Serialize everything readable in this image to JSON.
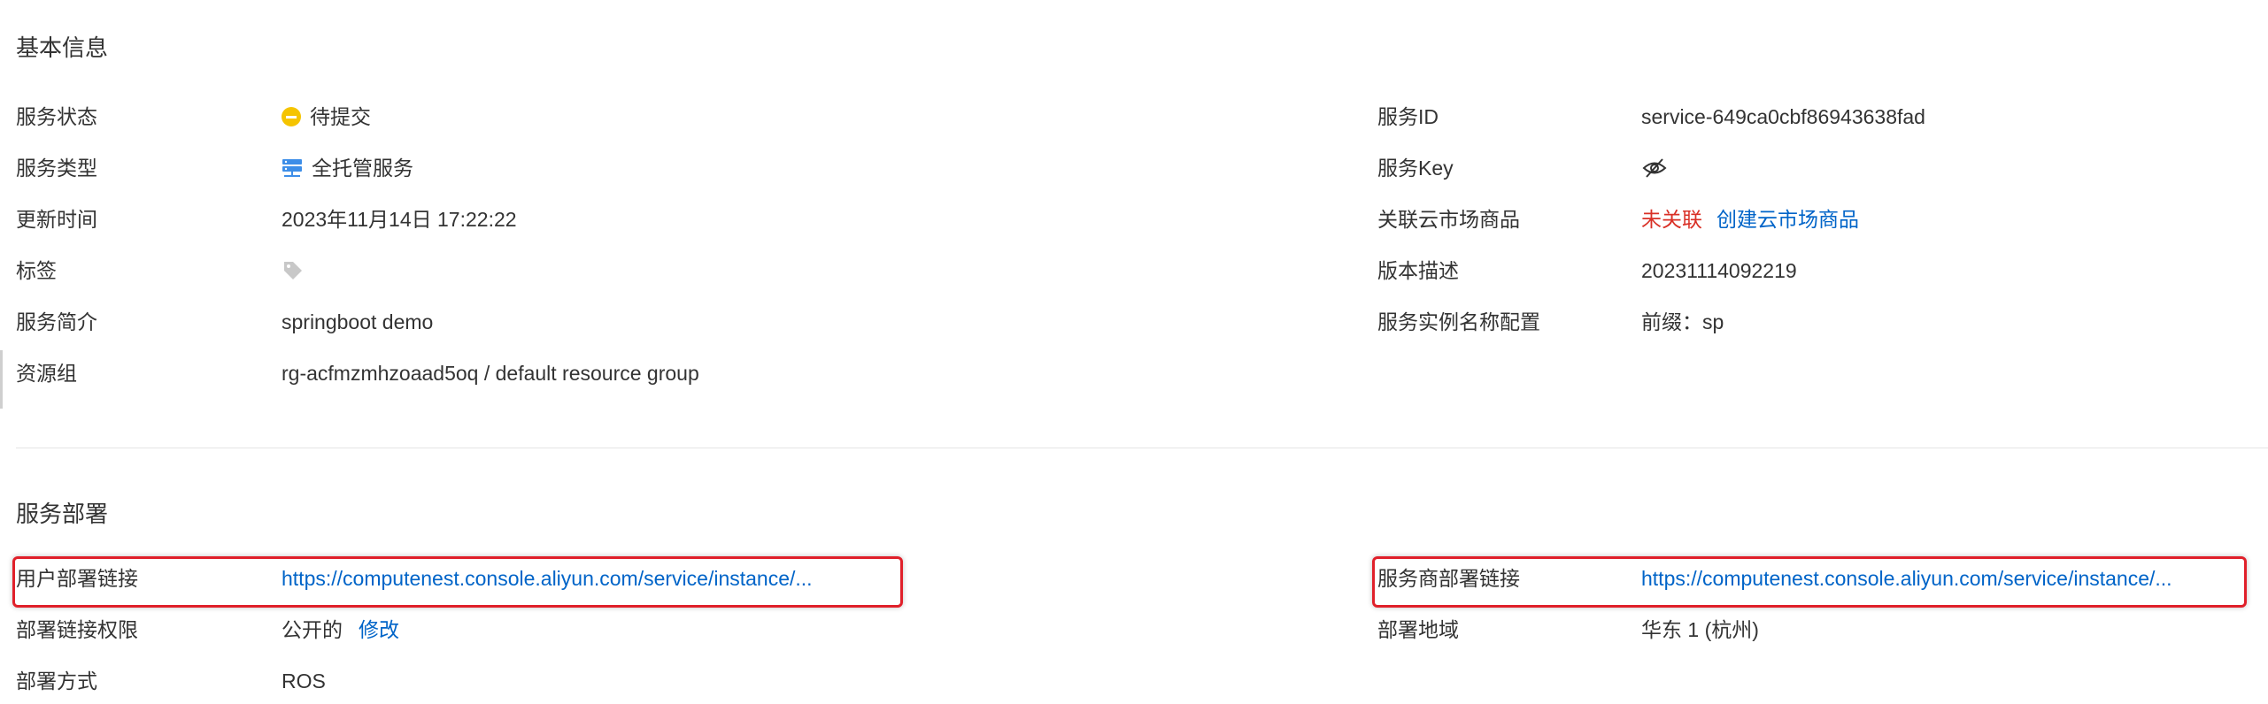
{
  "basic_info": {
    "title": "基本信息",
    "left": [
      {
        "label": "服务状态",
        "value": "待提交"
      },
      {
        "label": "服务类型",
        "value": "全托管服务"
      },
      {
        "label": "更新时间",
        "value": "2023年11月14日 17:22:22"
      },
      {
        "label": "标签",
        "value": ""
      },
      {
        "label": "服务简介",
        "value": "springboot demo"
      },
      {
        "label": "资源组",
        "value": "rg-acfmzmhzoaad5oq / default resource group"
      }
    ],
    "right": [
      {
        "label": "服务ID",
        "value": "service-649ca0cbf86943638fad"
      },
      {
        "label": "服务Key",
        "value": ""
      },
      {
        "label": "关联云市场商品",
        "value": "未关联",
        "link": "创建云市场商品"
      },
      {
        "label": "版本描述",
        "value": "20231114092219"
      },
      {
        "label": "服务实例名称配置",
        "value": "前缀：sp"
      }
    ]
  },
  "deployment": {
    "title": "服务部署",
    "left": [
      {
        "label": "用户部署链接",
        "value": "https://computenest.console.aliyun.com/service/instance/..."
      },
      {
        "label": "部署链接权限",
        "value": "公开的",
        "link": "修改"
      },
      {
        "label": "部署方式",
        "value": "ROS"
      }
    ],
    "right": [
      {
        "label": "服务商部署链接",
        "value": "https://computenest.console.aliyun.com/service/instance/..."
      },
      {
        "label": "部署地域",
        "value": "华东 1 (杭州)"
      }
    ]
  },
  "colors": {
    "link": "#0064c8",
    "status_pending": "#f5c400",
    "unlinked": "#d93026",
    "highlight": "#e0202a"
  }
}
